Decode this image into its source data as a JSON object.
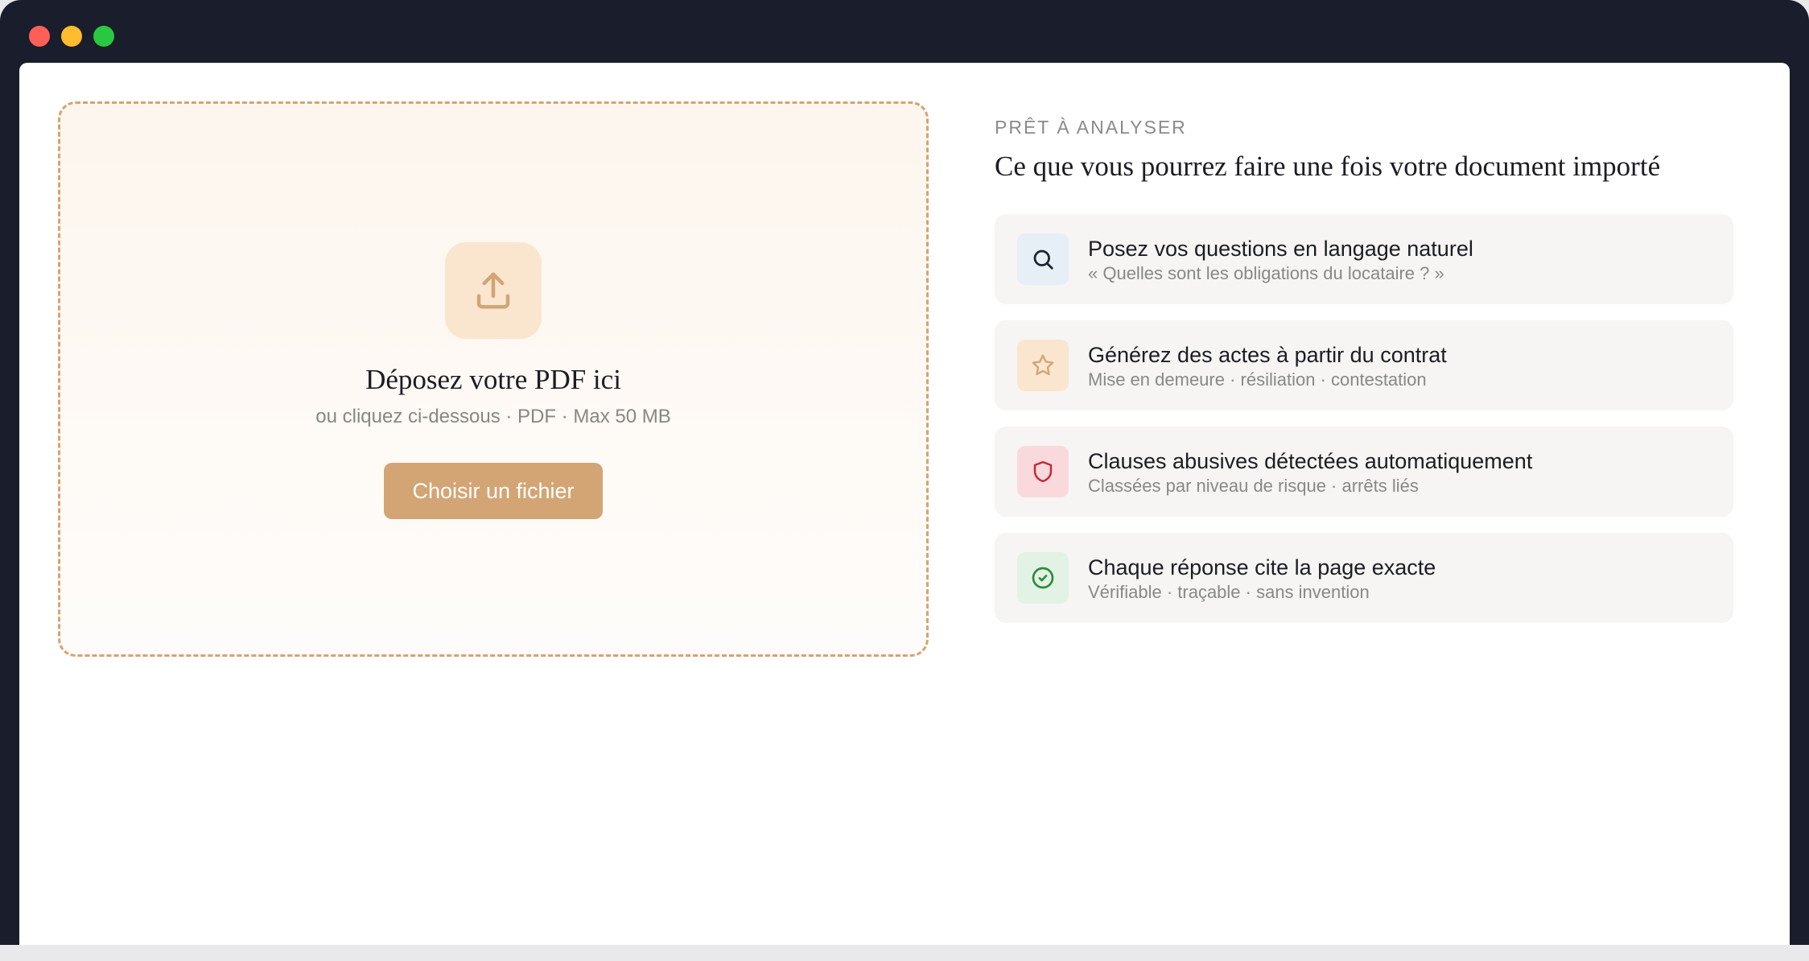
{
  "window": {
    "controls": [
      "close",
      "minimize",
      "maximize"
    ]
  },
  "dropzone": {
    "icon": "upload-icon",
    "title": "Déposez votre PDF ici",
    "subtitle": "ou cliquez ci-dessous · PDF · Max 50 MB",
    "button_label": "Choisir un fichier"
  },
  "panel": {
    "eyebrow": "PRÊT À ANALYSER",
    "headline": "Ce que vous pourrez faire une fois votre document importé",
    "features": [
      {
        "icon": "search-icon",
        "title": "Posez vos questions en langage naturel",
        "subtitle": "« Quelles sont les obligations du locataire ? »"
      },
      {
        "icon": "star-icon",
        "title": "Générez des actes à partir du contrat",
        "subtitle": "Mise en demeure · résiliation · contestation"
      },
      {
        "icon": "shield-icon",
        "title": "Clauses abusives détectées automatiquement",
        "subtitle": "Classées par niveau de risque · arrêts liés"
      },
      {
        "icon": "check-circle-icon",
        "title": "Chaque réponse cite la page exacte",
        "subtitle": "Vérifiable · traçable · sans invention"
      }
    ]
  },
  "colors": {
    "accent": "#d3a574",
    "window_chrome": "#1a1d2b",
    "text_primary": "#1c1d24",
    "text_muted": "#888888"
  }
}
